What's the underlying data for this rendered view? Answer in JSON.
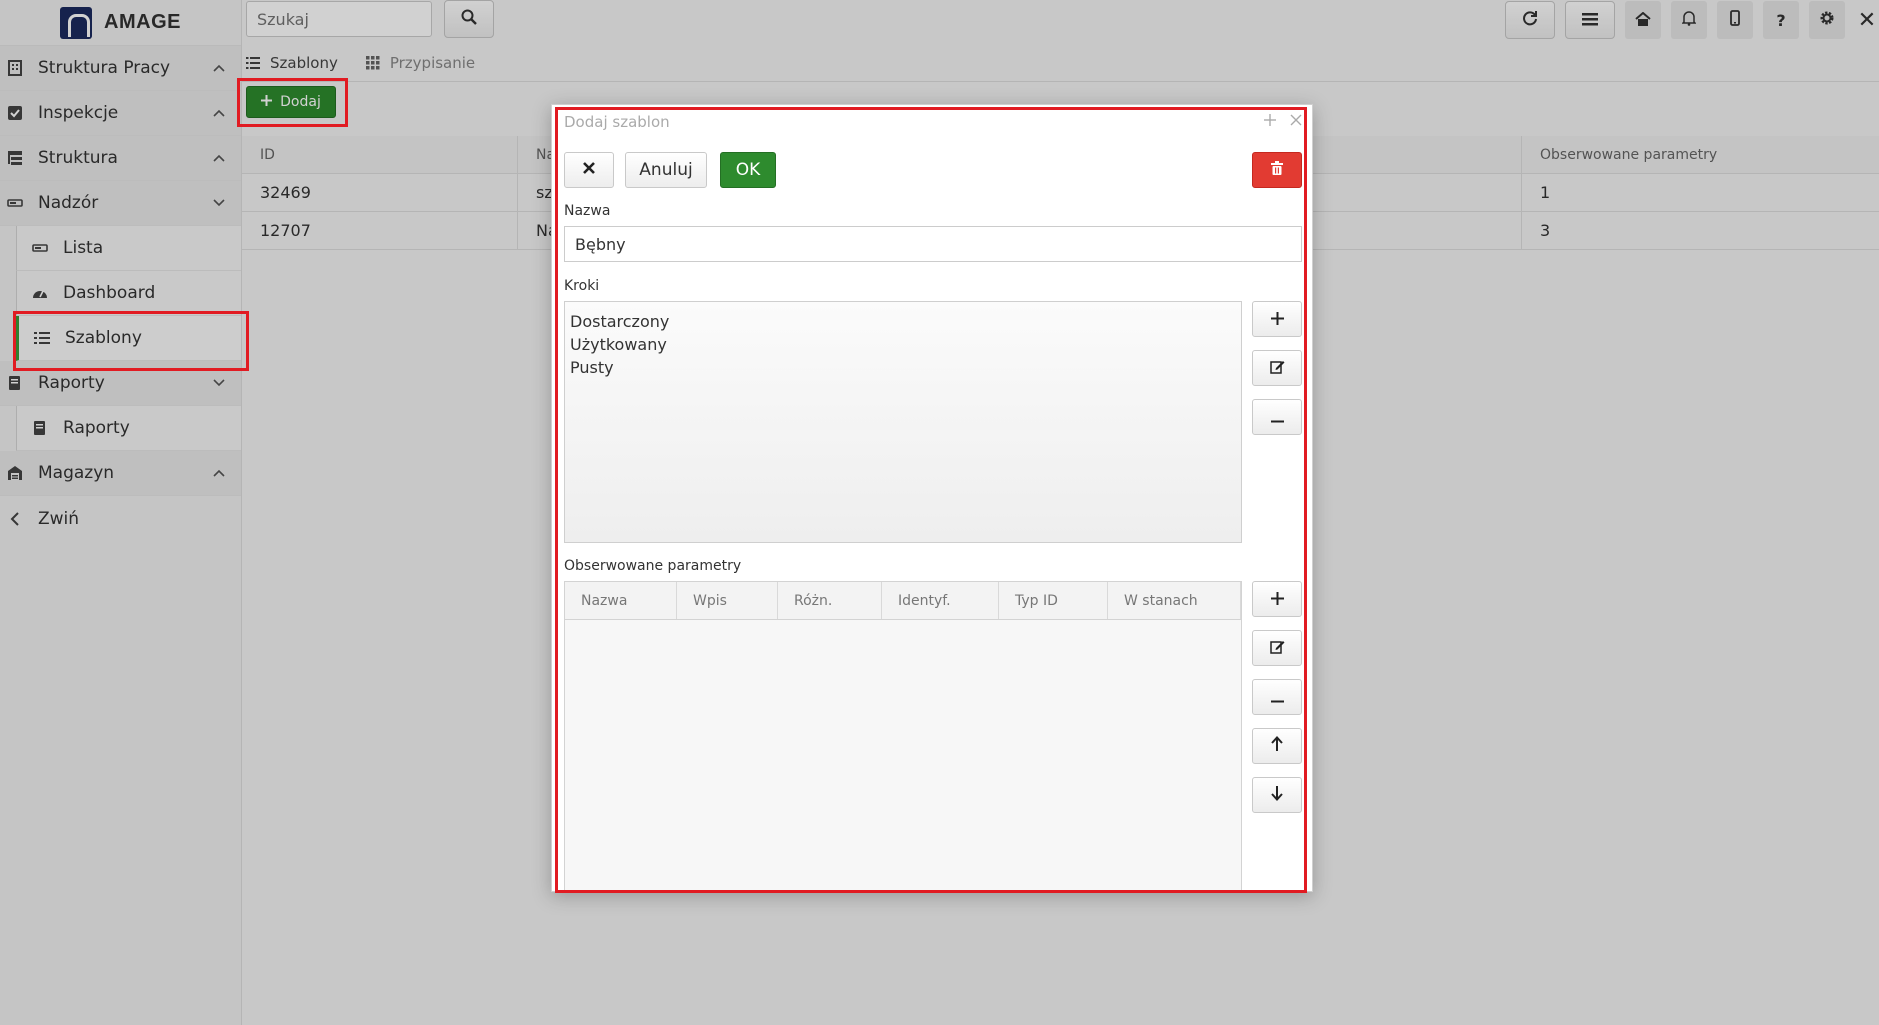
{
  "app": {
    "name": "AMAGE"
  },
  "sidebar": {
    "items": [
      {
        "label": "Struktura Pracy",
        "icon": "building-icon",
        "expanded": false
      },
      {
        "label": "Inspekcje",
        "icon": "checkbox-icon",
        "expanded": false
      },
      {
        "label": "Struktura",
        "icon": "sitemap-icon",
        "expanded": false
      },
      {
        "label": "Nadzór",
        "icon": "tag-icon",
        "expanded": true
      },
      {
        "label": "Lista",
        "icon": "tag-icon"
      },
      {
        "label": "Dashboard",
        "icon": "gauge-icon"
      },
      {
        "label": "Szablony",
        "icon": "list-icon",
        "active": true
      },
      {
        "label": "Raporty",
        "icon": "report-icon",
        "expanded": true
      },
      {
        "label": "Raporty",
        "icon": "report-icon"
      },
      {
        "label": "Magazyn",
        "icon": "warehouse-icon",
        "expanded": false
      },
      {
        "label": "Zwiń",
        "icon": "chevron-left-icon"
      }
    ]
  },
  "topbar": {
    "search_placeholder": "Szukaj",
    "icons": [
      "refresh-icon",
      "menu-icon",
      "home-icon",
      "bell-icon",
      "mobile-icon",
      "help-icon",
      "gear-icon",
      "close-icon"
    ],
    "help_glyph": "?",
    "close_glyph": "✕"
  },
  "tabs": [
    {
      "label": "Szablony",
      "active": true
    },
    {
      "label": "Przypisanie",
      "active": false
    }
  ],
  "toolbar": {
    "add_label": "Dodaj"
  },
  "table": {
    "columns": [
      "ID",
      "Na",
      "Obserwowane parametry"
    ],
    "rows": [
      {
        "id": "32469",
        "name": "sz",
        "params": "1"
      },
      {
        "id": "12707",
        "name": "Na",
        "params": "3"
      }
    ]
  },
  "dialog": {
    "title": "Dodaj szablon",
    "cancel_label": "Anuluj",
    "ok_label": "OK",
    "name_label": "Nazwa",
    "name_value": "Bębny",
    "steps_label": "Kroki",
    "steps": [
      "Dostarczony",
      "Użytkowany",
      "Pusty"
    ],
    "params_label": "Obserwowane parametry",
    "param_columns": [
      "Nazwa",
      "Wpis",
      "Różn.",
      "Identyf.",
      "Typ ID",
      "W stanach"
    ]
  },
  "colors": {
    "accent_green": "#2e8b2e",
    "danger_red": "#e23b32",
    "highlight_red": "#e11b22",
    "brand_navy": "#1b2a5e"
  }
}
